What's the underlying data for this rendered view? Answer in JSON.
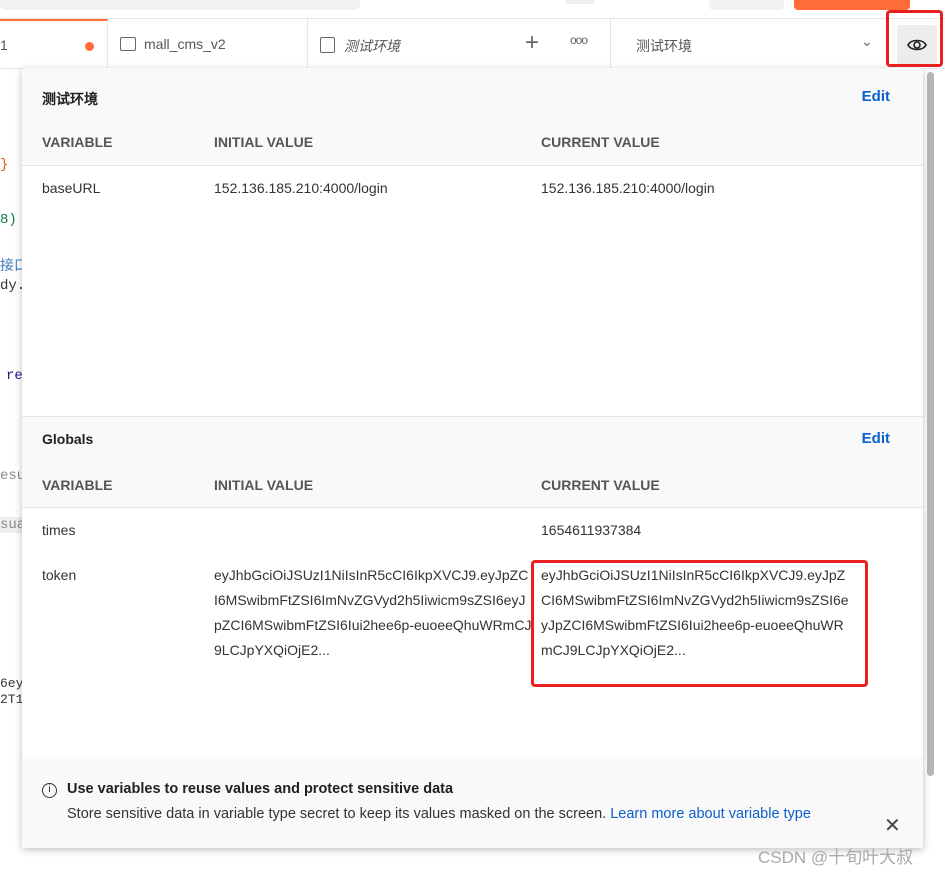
{
  "tabs": {
    "active_fragment": "1",
    "collection": "mall_cms_v2",
    "environment_tab": "测试环境",
    "env_select": "测试环境"
  },
  "background_fragments": [
    "}",
    "8)",
    "接口",
    "dy.",
    "re",
    "esu",
    "sua",
    "6ey",
    "2T1"
  ],
  "environment": {
    "title": "测试环境",
    "edit": "Edit",
    "headers": [
      "VARIABLE",
      "INITIAL VALUE",
      "CURRENT VALUE"
    ],
    "rows": [
      {
        "variable": "baseURL",
        "initial": "152.136.185.210:4000/login",
        "current": "152.136.185.210:4000/login"
      }
    ]
  },
  "globals": {
    "title": "Globals",
    "edit": "Edit",
    "headers": [
      "VARIABLE",
      "INITIAL VALUE",
      "CURRENT VALUE"
    ],
    "rows": [
      {
        "variable": "times",
        "initial": "",
        "current": "1654611937384"
      },
      {
        "variable": "token",
        "initial": "eyJhbGciOiJSUzI1NiIsInR5cCI6IkpXVCJ9.eyJpZCI6MSwibmFtZSI6ImNvZGVyd2h5Iiwicm9sZSI6eyJpZCI6MSwibmFtZSI6Iui2hee6p-euoeeQhuWRmCJ9LCJpYXQiOjE2...",
        "current": "eyJhbGciOiJSUzI1NiIsInR5cCI6IkpXVCJ9.eyJpZCI6MSwibmFtZSI6ImNvZGVyd2h5Iiwicm9sZSI6eyJpZCI6MSwibmFtZSI6Iui2hee6p-euoeeQhuWRmCJ9LCJpYXQiOjE2..."
      }
    ]
  },
  "info": {
    "title": "Use variables to reuse values and protect sensitive data",
    "text": "Store sensitive data in variable type secret to keep its values masked on the screen. ",
    "link": "Learn more about variable type"
  },
  "watermark": "CSDN @十旬叶大叔",
  "colors": {
    "accent": "#ff6c37",
    "link": "#0b5fcc",
    "highlight": "#e9201f"
  }
}
